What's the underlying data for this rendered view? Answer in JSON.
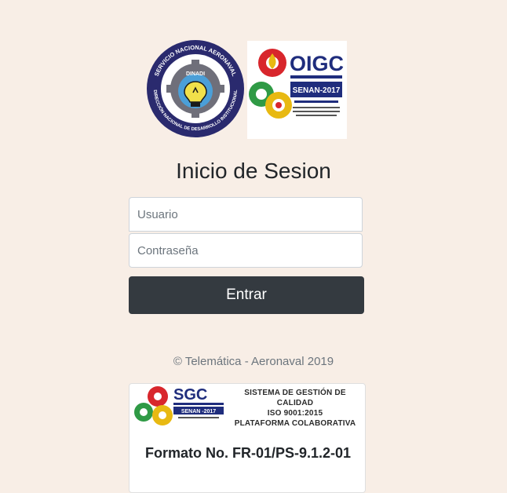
{
  "logos": {
    "dinadi_ring_top": "SERVICIO NACIONAL AERONAVAL",
    "dinadi_ring_bottom": "DIRECCIÓN NACIONAL DE DESARROLLO INSTITUCIONAL",
    "dinadi_center": "DINADI",
    "oigc_name": "OIGC",
    "oigc_badge": "SENAN-2017"
  },
  "login": {
    "title": "Inicio de Sesion",
    "username_placeholder": "Usuario",
    "password_placeholder": "Contraseña",
    "submit_label": "Entrar"
  },
  "footer": {
    "copyright": "© Telemática - Aeronaval 2019"
  },
  "card": {
    "sgc_name": "SGC",
    "sgc_badge": "SENAN -2017",
    "sgc_line1": "SISTEMA DE GESTIÓN DE CALIDAD",
    "sgc_line2": "ISO 9001:2015",
    "sgc_line3": "PLATAFORMA COLABORATIVA",
    "format_code": "Formato No. FR-01/PS-9.1.2-01"
  },
  "colors": {
    "background": "#f8eee6",
    "button": "#343a40",
    "navy": "#2a2a6e",
    "gear_red": "#d8262c",
    "gear_green": "#2f9a45",
    "gear_yellow": "#e8b912"
  }
}
